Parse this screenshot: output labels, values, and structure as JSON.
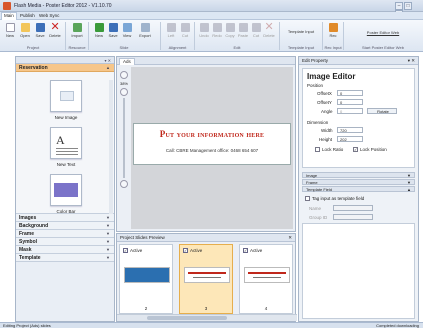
{
  "window": {
    "title": "Flash Media - Poster Editor 2012 - V1.10.70",
    "min": "–",
    "max": "□",
    "close": "×"
  },
  "menu": [
    "Main",
    "Publish",
    "Web Sync"
  ],
  "ribbon": {
    "buttons": [
      "New",
      "Open",
      "Save",
      "Delete",
      "Import",
      "New",
      "Save",
      "View",
      "Export",
      "Left",
      "Cut",
      "Undo",
      "Redo",
      "Copy",
      "Paste",
      "Cut",
      "Delete",
      "Template Input",
      "Rec",
      "Poster Editor Web"
    ],
    "groups": [
      "Project",
      "Resource",
      "Slide",
      "Alignment",
      "Edit",
      "Template Input",
      "Rec Input",
      "Start Poster Editor Web"
    ]
  },
  "left_panel": {
    "header": "▾ ✕",
    "sections": [
      {
        "label": "Reservation",
        "open": true
      },
      {
        "label": "Images"
      },
      {
        "label": "Background"
      },
      {
        "label": "Frame"
      },
      {
        "label": "Symbol"
      },
      {
        "label": "Mask"
      },
      {
        "label": "Template"
      }
    ],
    "gallery": [
      "New Image",
      "New Text",
      "Color Bar"
    ]
  },
  "editor": {
    "tab": "Ads",
    "zoom": "38%",
    "headline": "Put your information here",
    "subline": "Call: CBRE Management office: 0468 654 607"
  },
  "preview": {
    "title": "Project Slides Preview",
    "pin": "✕",
    "slides": [
      {
        "label": "Active",
        "num": "2"
      },
      {
        "label": "Active",
        "num": "3"
      },
      {
        "label": "Active",
        "num": "4"
      }
    ]
  },
  "properties": {
    "title": "Edit Property",
    "pin": "▾ ✕",
    "heading": "Image Editor",
    "position_label": "Position",
    "offsetx_label": "OffsetX",
    "offsetx": "0",
    "offsety_label": "OffsetY",
    "offsety": "0",
    "angle_label": "Angle",
    "angle": "0",
    "rotate_label": "Rotate",
    "dimension_label": "Dimension",
    "width_label": "Width",
    "width": "720",
    "height_label": "Height",
    "height": "202",
    "lock_ratio": "Lock Ratio",
    "lock_position": "Lock Position",
    "collapsibles": [
      "Image",
      "Frame",
      "Template Field"
    ],
    "tag_input": "Tag input as template field",
    "name_label": "Name",
    "group_label": "Group ID"
  },
  "status": {
    "left": "Editing Project (Ads) slides",
    "right": "Completed downloading"
  },
  "colors": {
    "accent": "#f6c68a",
    "headline": "#c0281c",
    "ribbon": "#dde6f2"
  }
}
